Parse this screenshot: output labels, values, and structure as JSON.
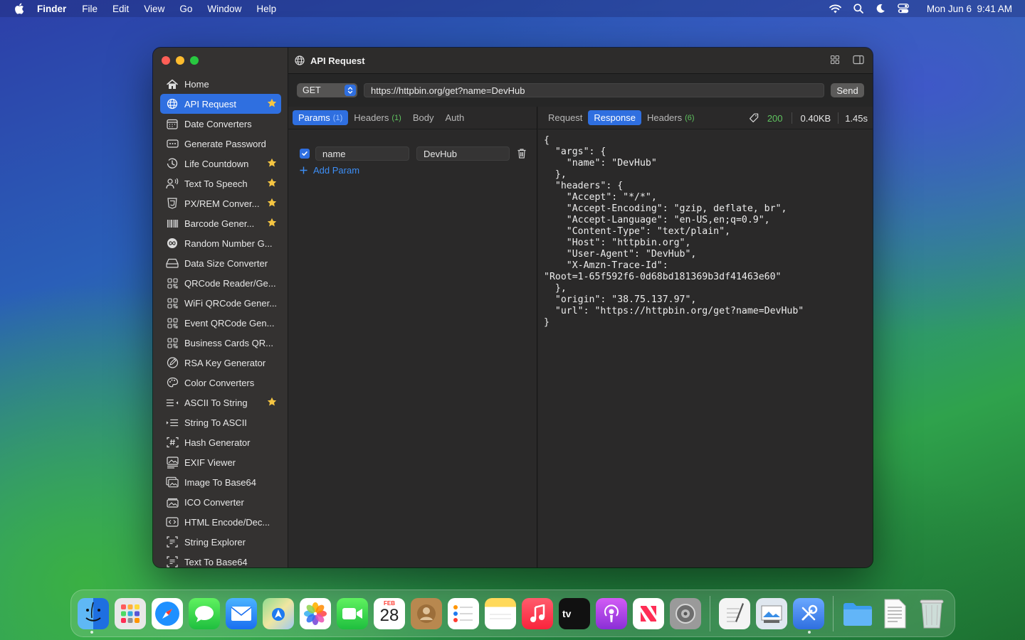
{
  "menubar": {
    "app_name": "Finder",
    "items": [
      "File",
      "Edit",
      "View",
      "Go",
      "Window",
      "Help"
    ],
    "clock": "Mon Jun 6  9:41 AM"
  },
  "window": {
    "title": "API Request"
  },
  "sidebar": {
    "items": [
      {
        "label": "Home",
        "icon": "house-icon",
        "starred": false,
        "active": false
      },
      {
        "label": "API Request",
        "icon": "globe-icon",
        "starred": true,
        "active": true
      },
      {
        "label": "Date Converters",
        "icon": "calendar-icon",
        "starred": false,
        "active": false
      },
      {
        "label": "Generate Password",
        "icon": "password-field-icon",
        "starred": false,
        "active": false
      },
      {
        "label": "Life Countdown",
        "icon": "clock-icon",
        "starred": true,
        "active": false
      },
      {
        "label": "Text To Speech",
        "icon": "speaking-person-icon",
        "starred": true,
        "active": false
      },
      {
        "label": "PX/REM Conver...",
        "icon": "css-badge-icon",
        "starred": true,
        "active": false
      },
      {
        "label": "Barcode Gener...",
        "icon": "barcode-icon",
        "starred": true,
        "active": false
      },
      {
        "label": "Random Number G...",
        "icon": "infinity-icon",
        "starred": false,
        "active": false
      },
      {
        "label": "Data Size Converter",
        "icon": "hard-drive-icon",
        "starred": false,
        "active": false
      },
      {
        "label": "QRCode Reader/Ge...",
        "icon": "qrcode-icon",
        "starred": false,
        "active": false
      },
      {
        "label": "WiFi QRCode Gener...",
        "icon": "qrcode-icon",
        "starred": false,
        "active": false
      },
      {
        "label": "Event QRCode Gen...",
        "icon": "qrcode-icon",
        "starred": false,
        "active": false
      },
      {
        "label": "Business Cards QR...",
        "icon": "qrcode-icon",
        "starred": false,
        "active": false
      },
      {
        "label": "RSA Key Generator",
        "icon": "signature-icon",
        "starred": false,
        "active": false
      },
      {
        "label": "Color Converters",
        "icon": "palette-icon",
        "starred": false,
        "active": false
      },
      {
        "label": "ASCII To String",
        "icon": "list-arrow-left-icon",
        "starred": true,
        "active": false
      },
      {
        "label": "String To ASCII",
        "icon": "list-arrow-right-icon",
        "starred": false,
        "active": false
      },
      {
        "label": "Hash Generator",
        "icon": "hash-frame-icon",
        "starred": false,
        "active": false
      },
      {
        "label": "EXIF Viewer",
        "icon": "photo-text-icon",
        "starred": false,
        "active": false
      },
      {
        "label": "Image To Base64",
        "icon": "photo-stack-icon",
        "starred": false,
        "active": false
      },
      {
        "label": "ICO Converter",
        "icon": "photo-frame-icon",
        "starred": false,
        "active": false
      },
      {
        "label": "HTML Encode/Dec...",
        "icon": "code-brackets-icon",
        "starred": false,
        "active": false
      },
      {
        "label": "String Explorer",
        "icon": "text-scan-icon",
        "starred": false,
        "active": false
      },
      {
        "label": "Text To Base64",
        "icon": "text-scan-icon",
        "starred": false,
        "active": false
      }
    ]
  },
  "request": {
    "method": "GET",
    "url": "https://httpbin.org/get?name=DevHub",
    "send_label": "Send",
    "tabs": [
      {
        "label": "Params",
        "count": "(1)",
        "active": true
      },
      {
        "label": "Headers",
        "count": "(1)",
        "active": false
      },
      {
        "label": "Body",
        "count": "",
        "active": false
      },
      {
        "label": "Auth",
        "count": "",
        "active": false
      }
    ],
    "params": [
      {
        "enabled": true,
        "key": "name",
        "value": "DevHub"
      }
    ],
    "add_param_label": "Add Param"
  },
  "response": {
    "tabs": [
      {
        "label": "Request",
        "count": "",
        "active": false
      },
      {
        "label": "Response",
        "count": "",
        "active": true
      },
      {
        "label": "Headers",
        "count": "(6)",
        "active": false
      }
    ],
    "status_code": "200",
    "size": "0.40KB",
    "time": "1.45s",
    "body": "{\n  \"args\": {\n    \"name\": \"DevHub\"\n  },\n  \"headers\": {\n    \"Accept\": \"*/*\",\n    \"Accept-Encoding\": \"gzip, deflate, br\",\n    \"Accept-Language\": \"en-US,en;q=0.9\",\n    \"Content-Type\": \"text/plain\",\n    \"Host\": \"httpbin.org\",\n    \"User-Agent\": \"DevHub\",\n    \"X-Amzn-Trace-Id\":\n\"Root=1-65f592f6-0d68bd181369b3df41463e60\"\n  },\n  \"origin\": \"38.75.137.97\",\n  \"url\": \"https://httpbin.org/get?name=DevHub\"\n}"
  },
  "calendar_icon": {
    "month": "FEB",
    "day": "28"
  },
  "colors": {
    "accent": "#2f6fe0",
    "status_ok": "#5fc35f",
    "star": "#f5c542",
    "link": "#3d8ef5"
  }
}
